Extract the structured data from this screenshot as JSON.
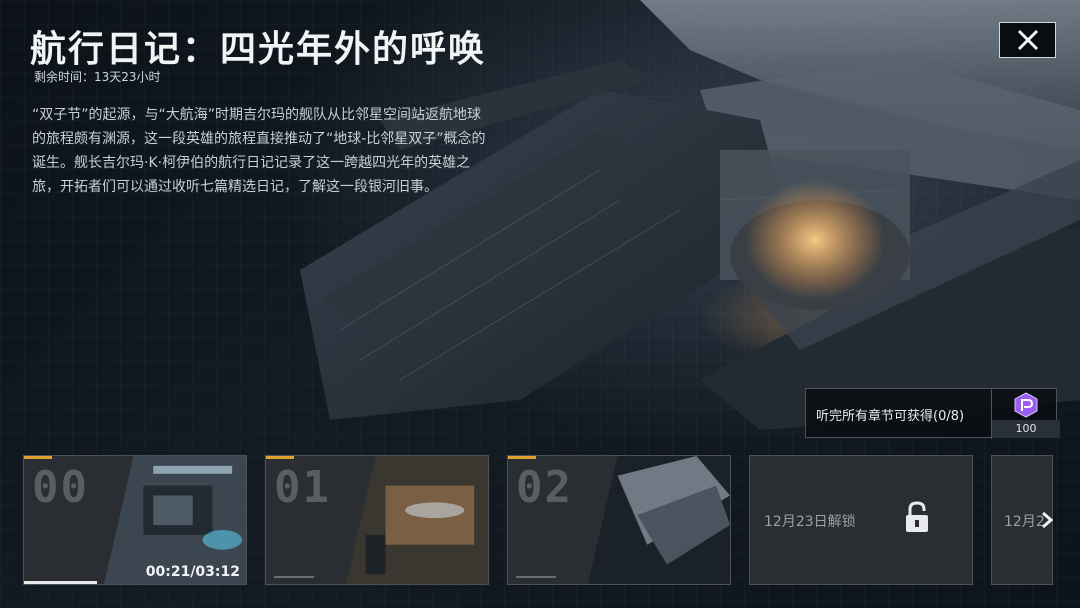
{
  "header": {
    "title": "航行日记：四光年外的呼唤",
    "timer": "剩余时间：13天23小时"
  },
  "description": "“双子节”的起源，与“大航海”时期吉尔玛的舰队从比邻星空间站返航地球的旅程颇有渊源，这一段英雄的旅程直接推动了“地球-比邻星双子”概念的诞生。舰长吉尔玛·K·柯伊伯的航行日记记录了这一跨越四光年的英雄之旅，开拓者们可以通过收听七篇精选日记，了解这一段银河旧事。",
  "reward": {
    "label": "听完所有章节可获得(0/8)",
    "count": "100",
    "icon": "purple-token-icon"
  },
  "chapters": [
    {
      "num": "00",
      "time": "00:21/03:12",
      "progress": 0.33
    },
    {
      "num": "01"
    },
    {
      "num": "02"
    },
    {
      "lock_text": "12月23日解锁"
    },
    {
      "lock_text": "12月2"
    }
  ],
  "colors": {
    "accent": "#e0a132",
    "reward_purple": "#9b5cf0"
  }
}
